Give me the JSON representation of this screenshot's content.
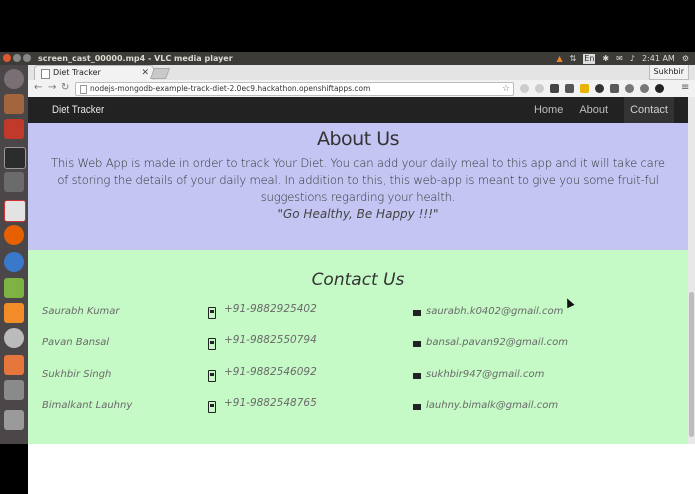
{
  "window": {
    "title": "screen_cast_00000.mp4 - VLC media player",
    "clock": "2:41 AM",
    "user": "Sukhbir",
    "keyboard_indicator": "En"
  },
  "browser": {
    "tab_title": "Diet Tracker",
    "url": "nodejs-mongodb-example-track-diet-2.0ec9.hackathon.openshiftapps.com"
  },
  "site": {
    "brand": "Diet Tracker",
    "nav": [
      "Home",
      "About",
      "Contact"
    ]
  },
  "about": {
    "heading": "About Us",
    "text": "This Web App is made in order to track Your Diet. You can add your daily meal to this app and it will take care of storing the details of your daily meal. In addition to this, this web-app is meant to give you some fruit-ful suggestions regarding your health.",
    "quote": "\"Go Healthy, Be Happy !!!\""
  },
  "contact": {
    "heading": "Contact Us",
    "people": [
      {
        "name": "Saurabh Kumar",
        "phone": "+91-9882925402",
        "email": "saurabh.k0402@gmail.com"
      },
      {
        "name": "Pavan Bansal",
        "phone": "+91-9882550794",
        "email": "bansal.pavan92@gmail.com"
      },
      {
        "name": "Sukhbir Singh",
        "phone": "+91-9882546092",
        "email": "sukhbir947@gmail.com"
      },
      {
        "name": "Bimalkant Lauhny",
        "phone": "+91-9882548765",
        "email": "lauhny.bimalk@gmail.com"
      }
    ]
  },
  "colors": {
    "about_bg": "#c5c5f4",
    "contact_bg": "#c5f9c5",
    "navbar_bg": "#222222"
  },
  "icons": {
    "phone": "phone-icon",
    "email": "mail-icon"
  }
}
